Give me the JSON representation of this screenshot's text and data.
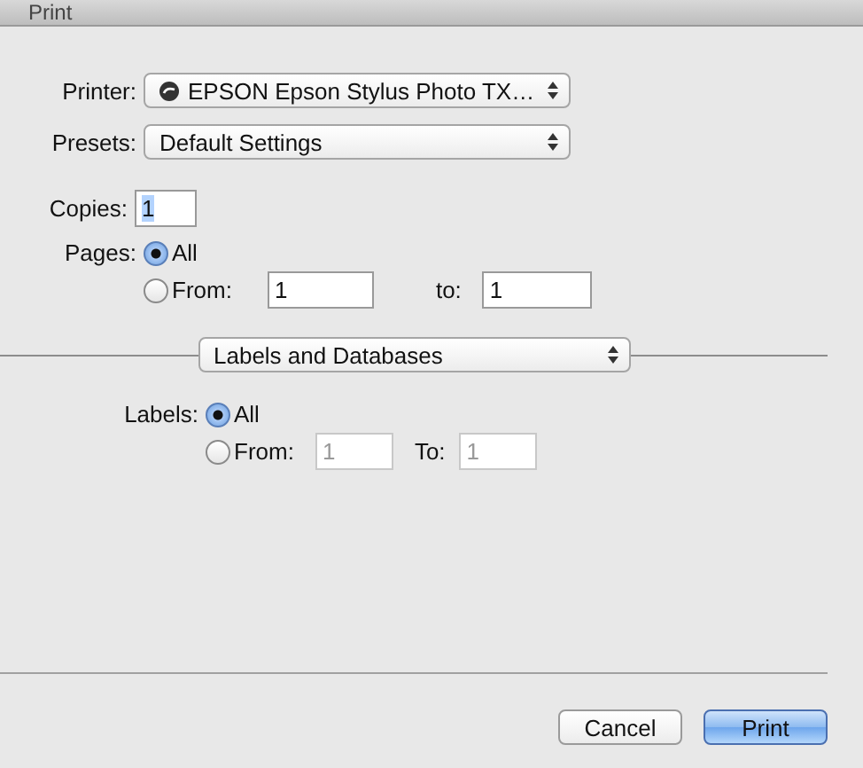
{
  "window": {
    "title": "Print"
  },
  "printer": {
    "label": "Printer:",
    "value": "EPSON Epson Stylus Photo TX…"
  },
  "presets": {
    "label": "Presets:",
    "value": "Default Settings"
  },
  "copies": {
    "label": "Copies:",
    "value": "1",
    "text_selected": true
  },
  "pages": {
    "label": "Pages:",
    "options": [
      {
        "label": "All",
        "selected": true
      },
      {
        "label": "From:",
        "selected": false
      }
    ],
    "from": {
      "value": "1",
      "disabled": false
    },
    "to_label": "to:",
    "to": {
      "value": "1",
      "disabled": false
    }
  },
  "section": {
    "value": "Labels and Databases"
  },
  "labels": {
    "label": "Labels:",
    "options": [
      {
        "label": "All",
        "selected": true
      },
      {
        "label": "From:",
        "selected": false
      }
    ],
    "from": {
      "value": "1",
      "disabled": true
    },
    "to_label": "To:",
    "to": {
      "value": "1",
      "disabled": true
    }
  },
  "buttons": [
    {
      "label": "Cancel",
      "kind": "normal"
    },
    {
      "label": "Print",
      "kind": "default"
    }
  ]
}
